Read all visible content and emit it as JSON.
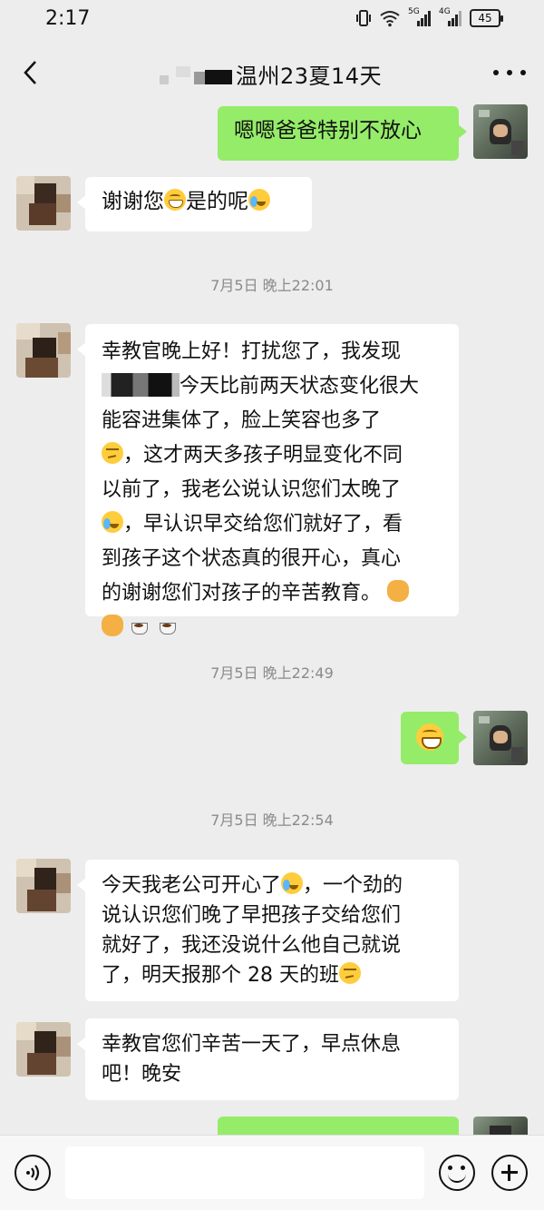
{
  "status_bar": {
    "time": "2:17",
    "battery": "45",
    "network_label_1": "5G",
    "network_label_2": "4G"
  },
  "header": {
    "title": "温州23夏14天",
    "back_icon": "chevron-left-icon",
    "more_icon": "more-dots-icon"
  },
  "messages": [
    {
      "id": "m1",
      "side": "right",
      "text": "嗯嗯爸爸特别不放心"
    },
    {
      "id": "m2",
      "side": "left",
      "text_a": "谢谢您",
      "text_b": "是的呢"
    },
    {
      "id": "t1",
      "type": "timestamp",
      "text": "7月5日 晚上22:01"
    },
    {
      "id": "m3",
      "side": "left",
      "line1": "幸教官晚上好！打扰您了，我发现",
      "line2": "今天比前两天状态变化很大",
      "line3": "能容进集体了，脸上笑容也多了",
      "line4": "，这才两天多孩子明显变化不同",
      "line5": "以前了，我老公说认识您们太晚了",
      "line6": "，早认识早交给您们就好了，看",
      "line7": "到孩子这个状态真的很开心，真心",
      "line8": "的谢谢您们对孩子的辛苦教育。"
    },
    {
      "id": "t2",
      "type": "timestamp",
      "text": "7月5日 晚上22:49"
    },
    {
      "id": "m4",
      "side": "right",
      "emoji": "grin-emoji"
    },
    {
      "id": "t3",
      "type": "timestamp",
      "text": "7月5日 晚上22:54"
    },
    {
      "id": "m5",
      "side": "left",
      "line1a": "今天我老公可开心了",
      "line1b": "，一个劲的",
      "line2": "说认识您们晚了早把孩子交给您们",
      "line3": "就好了，我还没说什么他自己就说",
      "line4": "了，明天报那个 28 天的班"
    },
    {
      "id": "m6",
      "side": "left",
      "line1": "幸教官您们辛苦一天了，早点休息",
      "line2": "吧！晚安"
    }
  ],
  "input_bar": {
    "voice_icon": "voice-icon",
    "emoji_icon": "emoji-icon",
    "plus_icon": "plus-icon"
  },
  "colors": {
    "background": "#ededed",
    "bubble_mine": "#95ec69",
    "bubble_theirs": "#ffffff",
    "timestamp_text": "#8a8a8a"
  }
}
